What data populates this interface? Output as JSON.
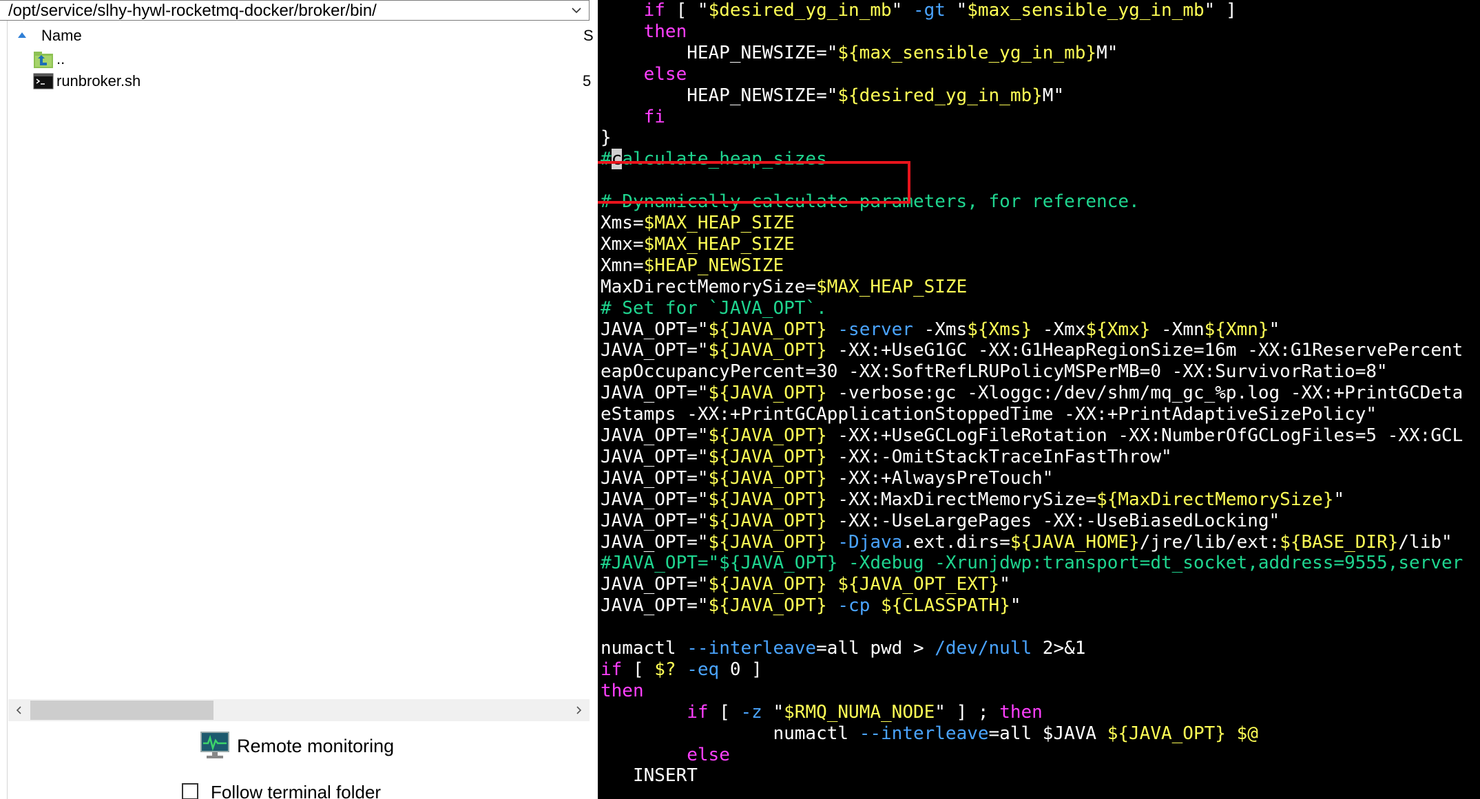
{
  "file_browser": {
    "path": "/opt/service/slhy-hywl-rocketmq-docker/broker/bin/",
    "columns": {
      "name": "Name",
      "size": "S"
    },
    "files": [
      {
        "name": "..",
        "size": "",
        "icon": "parent-folder-icon"
      },
      {
        "name": "runbroker.sh",
        "size": "5",
        "icon": "terminal-script-icon"
      }
    ],
    "remote_monitoring": "Remote monitoring",
    "follow_terminal_folder": "Follow terminal folder"
  },
  "terminal": {
    "colors": {
      "background": "#000000",
      "text": "#ffffff",
      "keyword": "#ff3fff",
      "variable": "#ffff55",
      "comment": "#1fd58f",
      "option": "#4aa4ff",
      "highlight_box": "#e8141c"
    },
    "lines": [
      [
        [
          "    ",
          "w"
        ],
        [
          "if",
          "m"
        ],
        [
          " [ \"",
          "w"
        ],
        [
          "$desired_yg_in_mb",
          "y"
        ],
        [
          "\" ",
          "w"
        ],
        [
          "-gt",
          "b"
        ],
        [
          " \"",
          "w"
        ],
        [
          "$max_sensible_yg_in_mb",
          "y"
        ],
        [
          "\" ]",
          "w"
        ]
      ],
      [
        [
          "    ",
          "w"
        ],
        [
          "then",
          "m"
        ]
      ],
      [
        [
          "        HEAP_NEWSIZE=\"",
          "w"
        ],
        [
          "${max_sensible_yg_in_mb}",
          "y"
        ],
        [
          "M\"",
          "w"
        ]
      ],
      [
        [
          "    ",
          "w"
        ],
        [
          "else",
          "m"
        ]
      ],
      [
        [
          "        HEAP_NEWSIZE=\"",
          "w"
        ],
        [
          "${desired_yg_in_mb}",
          "y"
        ],
        [
          "M\"",
          "w"
        ]
      ],
      [
        [
          "    ",
          "w"
        ],
        [
          "fi",
          "m"
        ]
      ],
      [
        [
          "}",
          "w"
        ]
      ],
      [
        [
          "#",
          "c"
        ],
        [
          "c",
          "cursor"
        ],
        [
          "alculate_heap_sizes",
          "c"
        ]
      ],
      [
        [
          "",
          "w"
        ]
      ],
      [
        [
          "# Dynamically calculate parameters, for reference.",
          "c"
        ]
      ],
      [
        [
          "Xms=",
          "w"
        ],
        [
          "$MAX_HEAP_SIZE",
          "y"
        ]
      ],
      [
        [
          "Xmx=",
          "w"
        ],
        [
          "$MAX_HEAP_SIZE",
          "y"
        ]
      ],
      [
        [
          "Xmn=",
          "w"
        ],
        [
          "$HEAP_NEWSIZE",
          "y"
        ]
      ],
      [
        [
          "MaxDirectMemorySize=",
          "w"
        ],
        [
          "$MAX_HEAP_SIZE",
          "y"
        ]
      ],
      [
        [
          "# Set for `JAVA_OPT`.",
          "c"
        ]
      ],
      [
        [
          "JAVA_OPT=\"",
          "w"
        ],
        [
          "${JAVA_OPT}",
          "y"
        ],
        [
          " ",
          "w"
        ],
        [
          "-server",
          "b"
        ],
        [
          " -Xms",
          "w"
        ],
        [
          "${Xms}",
          "y"
        ],
        [
          " -Xmx",
          "w"
        ],
        [
          "${Xmx}",
          "y"
        ],
        [
          " -Xmn",
          "w"
        ],
        [
          "${Xmn}",
          "y"
        ],
        [
          "\"",
          "w"
        ]
      ],
      [
        [
          "JAVA_OPT=\"",
          "w"
        ],
        [
          "${JAVA_OPT}",
          "y"
        ],
        [
          " -XX:+UseG1GC -XX:G1HeapRegionSize=16m -XX:G1ReservePercent",
          "w"
        ]
      ],
      [
        [
          "eapOccupancyPercent=30 -XX:SoftRefLRUPolicyMSPerMB=0 -XX:SurvivorRatio=8\"",
          "w"
        ]
      ],
      [
        [
          "JAVA_OPT=\"",
          "w"
        ],
        [
          "${JAVA_OPT}",
          "y"
        ],
        [
          " -verbose:gc -Xloggc:/dev/shm/mq_gc_%p.log -XX:+PrintGCDeta",
          "w"
        ]
      ],
      [
        [
          "eStamps -XX:+PrintGCApplicationStoppedTime -XX:+PrintAdaptiveSizePolicy\"",
          "w"
        ]
      ],
      [
        [
          "JAVA_OPT=\"",
          "w"
        ],
        [
          "${JAVA_OPT}",
          "y"
        ],
        [
          " -XX:+UseGCLogFileRotation -XX:NumberOfGCLogFiles=5 -XX:GCL",
          "w"
        ]
      ],
      [
        [
          "JAVA_OPT=\"",
          "w"
        ],
        [
          "${JAVA_OPT}",
          "y"
        ],
        [
          " -XX:-OmitStackTraceInFastThrow\"",
          "w"
        ]
      ],
      [
        [
          "JAVA_OPT=\"",
          "w"
        ],
        [
          "${JAVA_OPT}",
          "y"
        ],
        [
          " -XX:+AlwaysPreTouch\"",
          "w"
        ]
      ],
      [
        [
          "JAVA_OPT=\"",
          "w"
        ],
        [
          "${JAVA_OPT}",
          "y"
        ],
        [
          " -XX:MaxDirectMemorySize=",
          "w"
        ],
        [
          "${MaxDirectMemorySize}",
          "y"
        ],
        [
          "\"",
          "w"
        ]
      ],
      [
        [
          "JAVA_OPT=\"",
          "w"
        ],
        [
          "${JAVA_OPT}",
          "y"
        ],
        [
          " -XX:-UseLargePages -XX:-UseBiasedLocking\"",
          "w"
        ]
      ],
      [
        [
          "JAVA_OPT=\"",
          "w"
        ],
        [
          "${JAVA_OPT}",
          "y"
        ],
        [
          " ",
          "w"
        ],
        [
          "-Djava",
          "b"
        ],
        [
          ".ext.dirs=",
          "w"
        ],
        [
          "${JAVA_HOME}",
          "y"
        ],
        [
          "/jre/lib/ext:",
          "w"
        ],
        [
          "${BASE_DIR}",
          "y"
        ],
        [
          "/lib\"",
          "w"
        ]
      ],
      [
        [
          "#JAVA_OPT=\"${JAVA_OPT} -Xdebug -Xrunjdwp:transport=dt_socket,address=9555,server",
          "c"
        ]
      ],
      [
        [
          "JAVA_OPT=\"",
          "w"
        ],
        [
          "${JAVA_OPT}",
          "y"
        ],
        [
          " ",
          "w"
        ],
        [
          "${JAVA_OPT_EXT}",
          "y"
        ],
        [
          "\"",
          "w"
        ]
      ],
      [
        [
          "JAVA_OPT=\"",
          "w"
        ],
        [
          "${JAVA_OPT}",
          "y"
        ],
        [
          " ",
          "w"
        ],
        [
          "-cp",
          "b"
        ],
        [
          " ",
          "w"
        ],
        [
          "${CLASSPATH}",
          "y"
        ],
        [
          "\"",
          "w"
        ]
      ],
      [
        [
          "",
          "w"
        ]
      ],
      [
        [
          "numactl ",
          "w"
        ],
        [
          "--interleave",
          "b"
        ],
        [
          "=all pwd > ",
          "w"
        ],
        [
          "/dev/null",
          "b"
        ],
        [
          " 2>&1",
          "w"
        ]
      ],
      [
        [
          "if",
          "m"
        ],
        [
          " [ ",
          "w"
        ],
        [
          "$?",
          "y"
        ],
        [
          " ",
          "w"
        ],
        [
          "-eq",
          "b"
        ],
        [
          " 0 ]",
          "w"
        ]
      ],
      [
        [
          "then",
          "m"
        ]
      ],
      [
        [
          "        ",
          "w"
        ],
        [
          "if",
          "m"
        ],
        [
          " [ ",
          "w"
        ],
        [
          "-z",
          "b"
        ],
        [
          " \"",
          "w"
        ],
        [
          "$RMQ_NUMA_NODE",
          "y"
        ],
        [
          "\" ] ; ",
          "w"
        ],
        [
          "then",
          "m"
        ]
      ],
      [
        [
          "                numactl ",
          "w"
        ],
        [
          "--interleave",
          "b"
        ],
        [
          "=all $JAVA ",
          "w"
        ],
        [
          "${JAVA_OPT}",
          "y"
        ],
        [
          " ",
          "w"
        ],
        [
          "$@",
          "y"
        ]
      ],
      [
        [
          "        ",
          "w"
        ],
        [
          "else",
          "m"
        ]
      ],
      [
        [
          "   INSERT",
          "w"
        ]
      ]
    ]
  }
}
